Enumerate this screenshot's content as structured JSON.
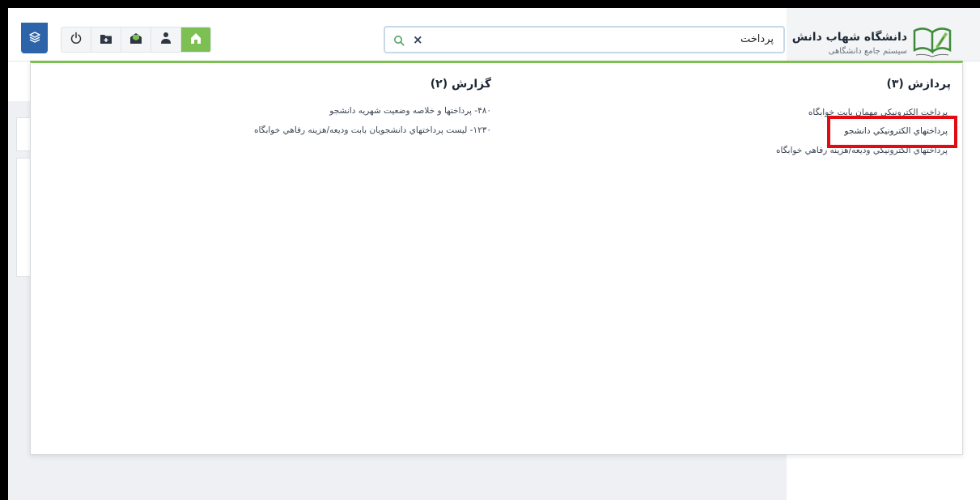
{
  "header": {
    "search": {
      "value": "پرداخت"
    },
    "toolbar": [
      "power-icon",
      "folder-add-icon",
      "inbox-icon",
      "user-icon",
      "home-icon"
    ],
    "layers_icon": "layers-icon",
    "brand": {
      "name": "دانشگاه شهاب دانش",
      "subtitle": "سیستم جامع دانشگاهی"
    }
  },
  "results": {
    "processing": {
      "title": "پردازش (۳)",
      "items": [
        "پرداخت الکترونيکي مهمان بابت خوابگاه",
        "پرداختهاي الکترونيکي دانشجو",
        "پرداختهاي الکترونيکي وديعه/هزينه رفاهي خوابگاه"
      ]
    },
    "report": {
      "title": "گزارش (۲)",
      "items": [
        "۴۸۰- پرداختها و خلاصه وضعيت شهريه دانشجو",
        "۱۲۳۰- ليست پرداختهاي دانشجويان بابت وديعه/هزينه رفاهي خوابگاه"
      ]
    }
  },
  "colors": {
    "accent_green": "#7cbf53",
    "layers_blue": "#2d63a8",
    "highlight_red": "#e30b12"
  }
}
